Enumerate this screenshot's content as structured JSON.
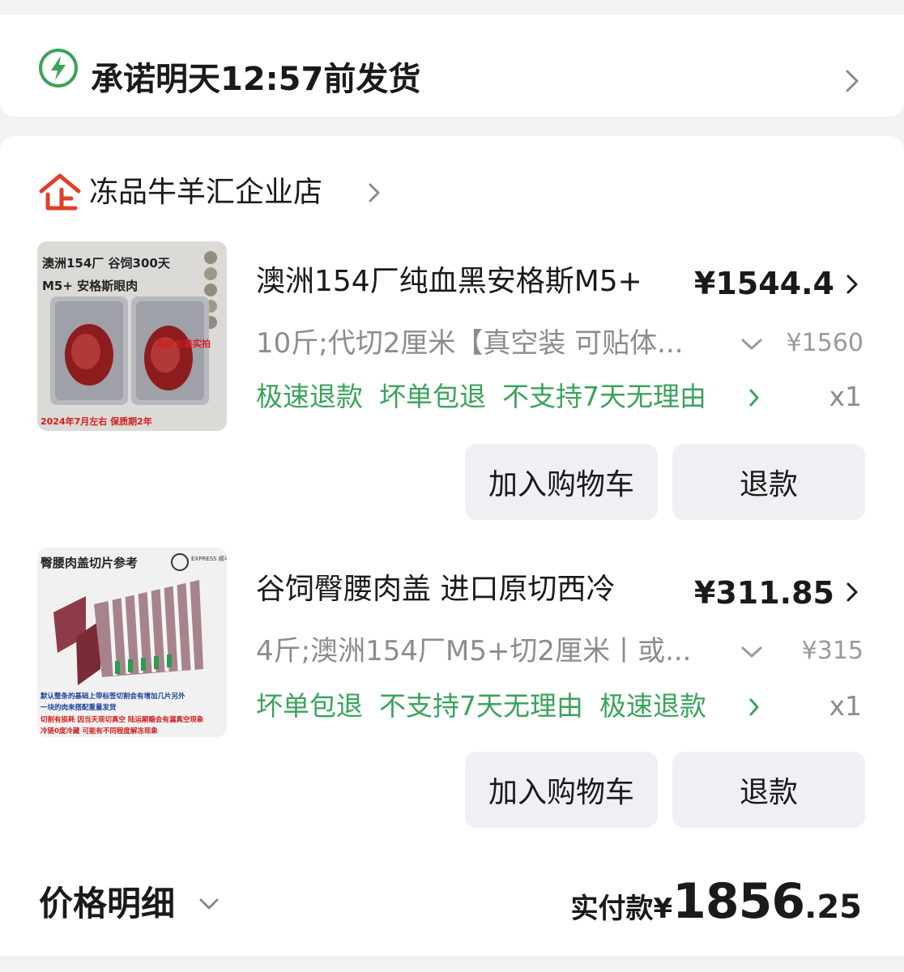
{
  "delivery": {
    "text": "承诺明天12:57前发货"
  },
  "store": {
    "badge": "企",
    "name": "冻品牛羊汇企业店"
  },
  "items": [
    {
      "image_text": [
        "澳洲154厂 谷饲300天",
        "M5+ 安格斯眼肉",
        "贴体包装实拍",
        "2024年7月左右 保质期2年"
      ],
      "title": "澳洲154厂纯血黑安格斯M5+",
      "price": "¥1544.4",
      "spec": "10斤;代切2厘米【真空装 可贴体...",
      "original_price": "¥1560",
      "tags": [
        "极速退款",
        "坏单包退",
        "不支持7天无理由"
      ],
      "quantity": "x1",
      "cart_label": "加入购物车",
      "refund_label": "退款"
    },
    {
      "image_text": [
        "臀腰肉盖切片参考",
        "EXPRESS 顺丰冷链",
        "默认整条的基础上带标签切割会有增加几片另外",
        "一块的肉来搭配重量发货",
        "切割有损耗 因当天现切真空 陆运颠簸会有漏真空现象",
        "冷链0度冷藏 可能有不同程度解冻现象"
      ],
      "title": "谷饲臀腰肉盖 进口原切西冷",
      "price": "¥311.85",
      "spec": "4斤;澳洲154厂M5+切2厘米丨或...",
      "original_price": "¥315",
      "tags": [
        "坏单包退",
        "不支持7天无理由",
        "极速退款"
      ],
      "quantity": "x1",
      "cart_label": "加入购物车",
      "refund_label": "退款"
    }
  ],
  "summary": {
    "price_detail_label": "价格明细",
    "paid_label": "实付款¥",
    "paid_integer": "1856",
    "paid_decimal": ".25"
  },
  "colors": {
    "green": "#3aa35b",
    "store_red": "#e0402b",
    "button_bg": "#eef0f3"
  },
  "icons": {
    "delivery": "lightning-icon",
    "store": "enterprise-icon",
    "chevron": "chevron-right-icon",
    "dropdown": "chevron-down-icon"
  }
}
